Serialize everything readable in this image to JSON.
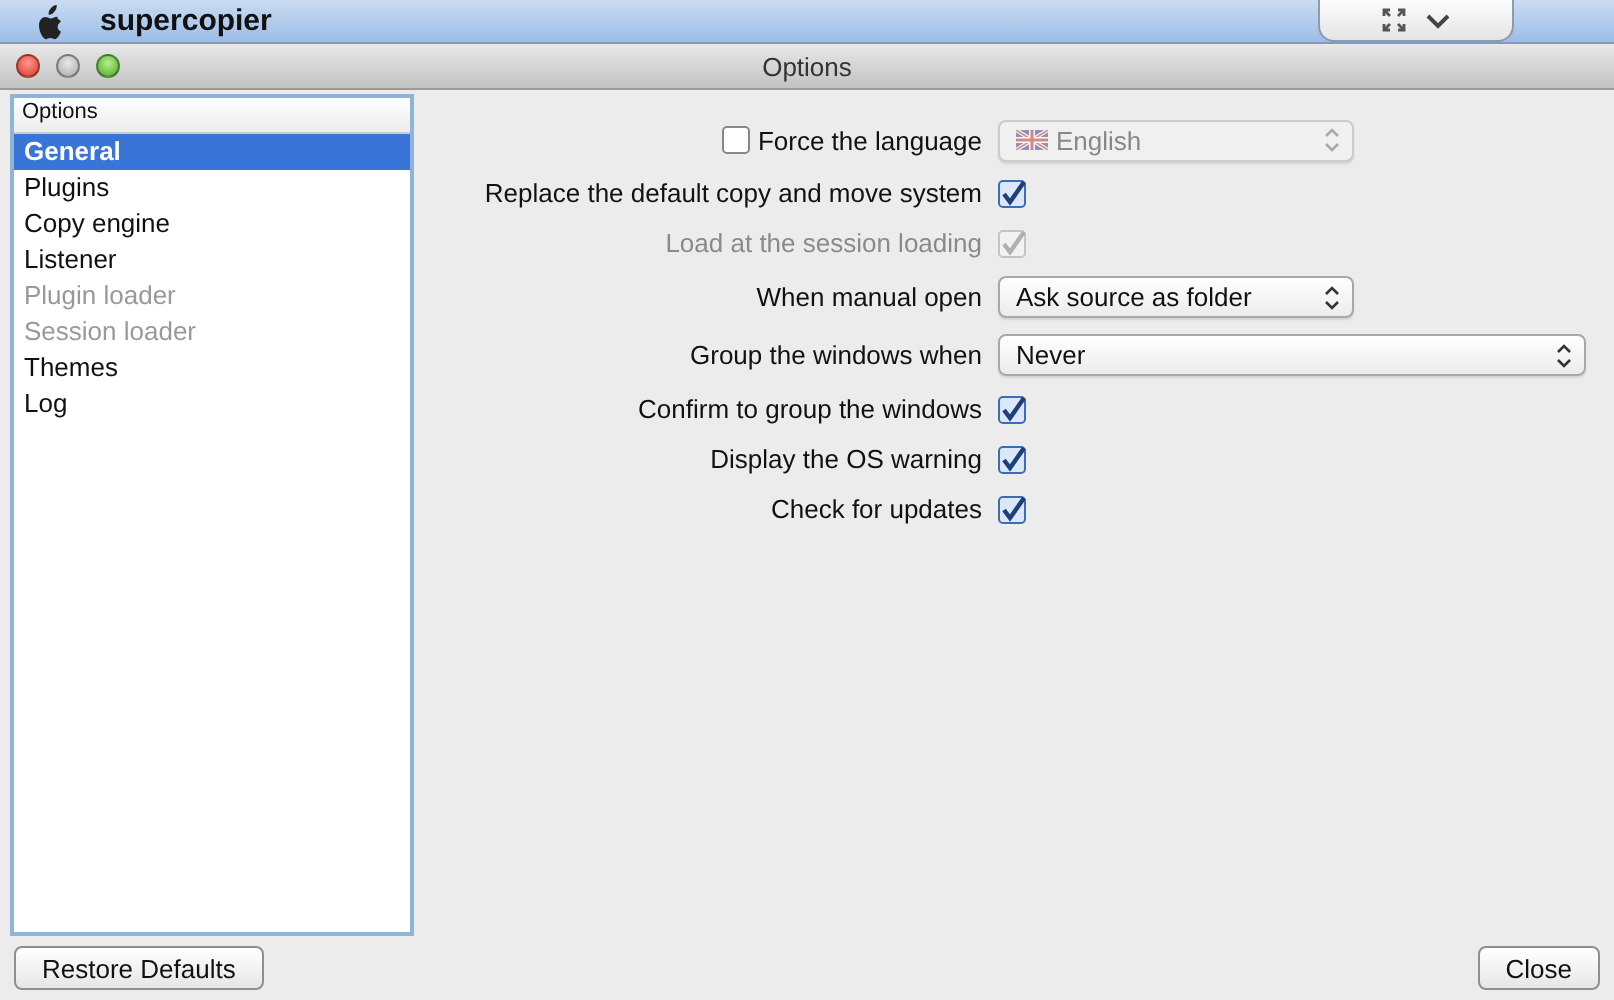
{
  "menu_bar": {
    "app_name": "supercopier"
  },
  "window": {
    "title": "Options"
  },
  "sidebar": {
    "header": "Options",
    "items": [
      {
        "label": "General",
        "selected": true,
        "disabled": false
      },
      {
        "label": "Plugins",
        "selected": false,
        "disabled": false
      },
      {
        "label": "Copy engine",
        "selected": false,
        "disabled": false
      },
      {
        "label": "Listener",
        "selected": false,
        "disabled": false
      },
      {
        "label": "Plugin loader",
        "selected": false,
        "disabled": true
      },
      {
        "label": "Session loader",
        "selected": false,
        "disabled": true
      },
      {
        "label": "Themes",
        "selected": false,
        "disabled": false
      },
      {
        "label": "Log",
        "selected": false,
        "disabled": false
      }
    ]
  },
  "settings": [
    {
      "kind": "checkbox_select",
      "label": "Force the language",
      "checked": false,
      "value": "English",
      "disabled": true
    },
    {
      "kind": "checkbox",
      "label": "Replace the default copy and move system",
      "checked": true,
      "disabled": false
    },
    {
      "kind": "checkbox",
      "label": "Load at the session loading",
      "checked": true,
      "disabled": true
    },
    {
      "kind": "select",
      "label": "When manual open",
      "value": "Ask source as folder",
      "disabled": false
    },
    {
      "kind": "select",
      "label": "Group the windows when",
      "value": "Never",
      "disabled": false
    },
    {
      "kind": "checkbox",
      "label": "Confirm to group the windows",
      "checked": true,
      "disabled": false
    },
    {
      "kind": "checkbox",
      "label": "Display the OS warning",
      "checked": true,
      "disabled": false
    },
    {
      "kind": "checkbox",
      "label": "Check for updates",
      "checked": true,
      "disabled": false
    }
  ],
  "buttons": [
    {
      "label": "Restore Defaults"
    },
    {
      "label": "Close"
    }
  ]
}
